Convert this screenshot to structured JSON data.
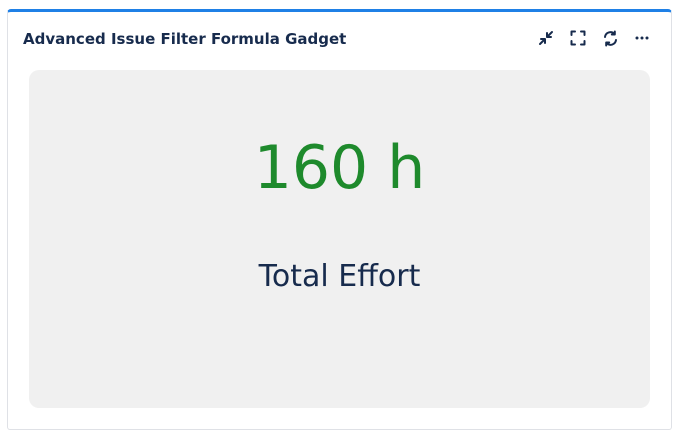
{
  "gadget": {
    "title": "Advanced Issue Filter Formula Gadget",
    "actions": {
      "minimize_icon": "minimize-icon",
      "fullscreen_icon": "fullscreen-icon",
      "refresh_icon": "refresh-icon",
      "more_icon": "more-icon"
    },
    "metric": {
      "value": "160 h",
      "label": "Total Effort"
    }
  },
  "colors": {
    "accent": "#1f80e6",
    "value": "#1e8a2c",
    "text": "#172b4d",
    "card_bg": "#f0f0f0"
  }
}
